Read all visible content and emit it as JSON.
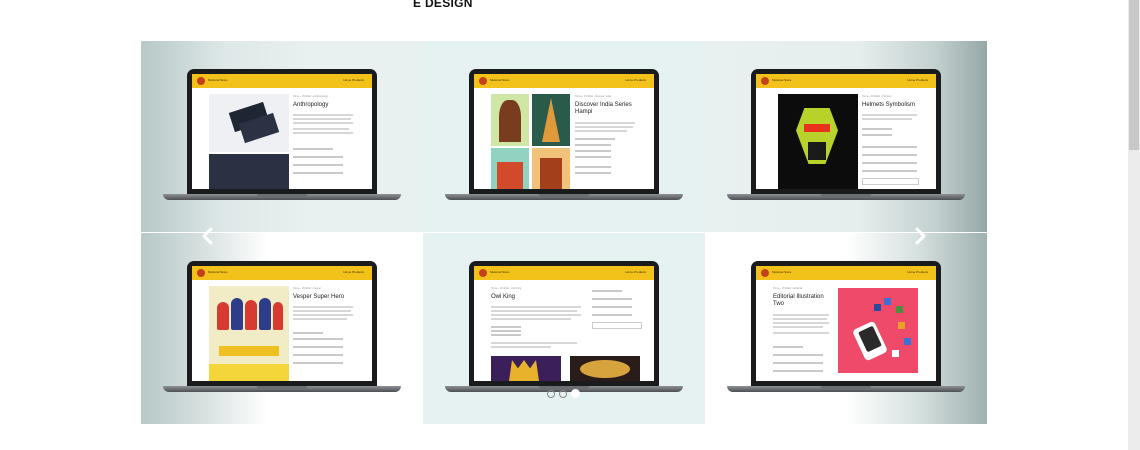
{
  "page": {
    "heading": "E DESIGN"
  },
  "carousel": {
    "prev_icon": "chevron-left-icon",
    "next_icon": "chevron-right-icon",
    "active_dot": 3,
    "dot_count": 3,
    "slides": [
      {
        "site_name": "Motional Store",
        "nav": "Home   Products",
        "crumbs": "Home › Portfolio › Anthropology",
        "title": "Anthropology"
      },
      {
        "site_name": "Motional Store",
        "nav": "Home   Products",
        "crumbs": "Home › Portfolio › Discover India",
        "title": "Discover India Series Hampi"
      },
      {
        "site_name": "Motional Store",
        "nav": "Home   Products",
        "crumbs": "Home › Portfolio › Helmets",
        "title": "Helmets Symbolism"
      },
      {
        "site_name": "Motional Store",
        "nav": "Home   Products",
        "crumbs": "Home › Portfolio › Vesper",
        "title": "Vesper Super Hero"
      },
      {
        "site_name": "Motional Store",
        "nav": "Home   Products",
        "crumbs": "Home › Portfolio › Owl King",
        "title": "Owl King"
      },
      {
        "site_name": "Motional Store",
        "nav": "Home   Products",
        "crumbs": "Home › Portfolio › Editorial",
        "title": "Editorial Illustration Two"
      }
    ]
  },
  "colors": {
    "site_header": "#f3c21a",
    "laptop_body": "#1a1b1d",
    "tile_bg": "#e6f1f2"
  }
}
